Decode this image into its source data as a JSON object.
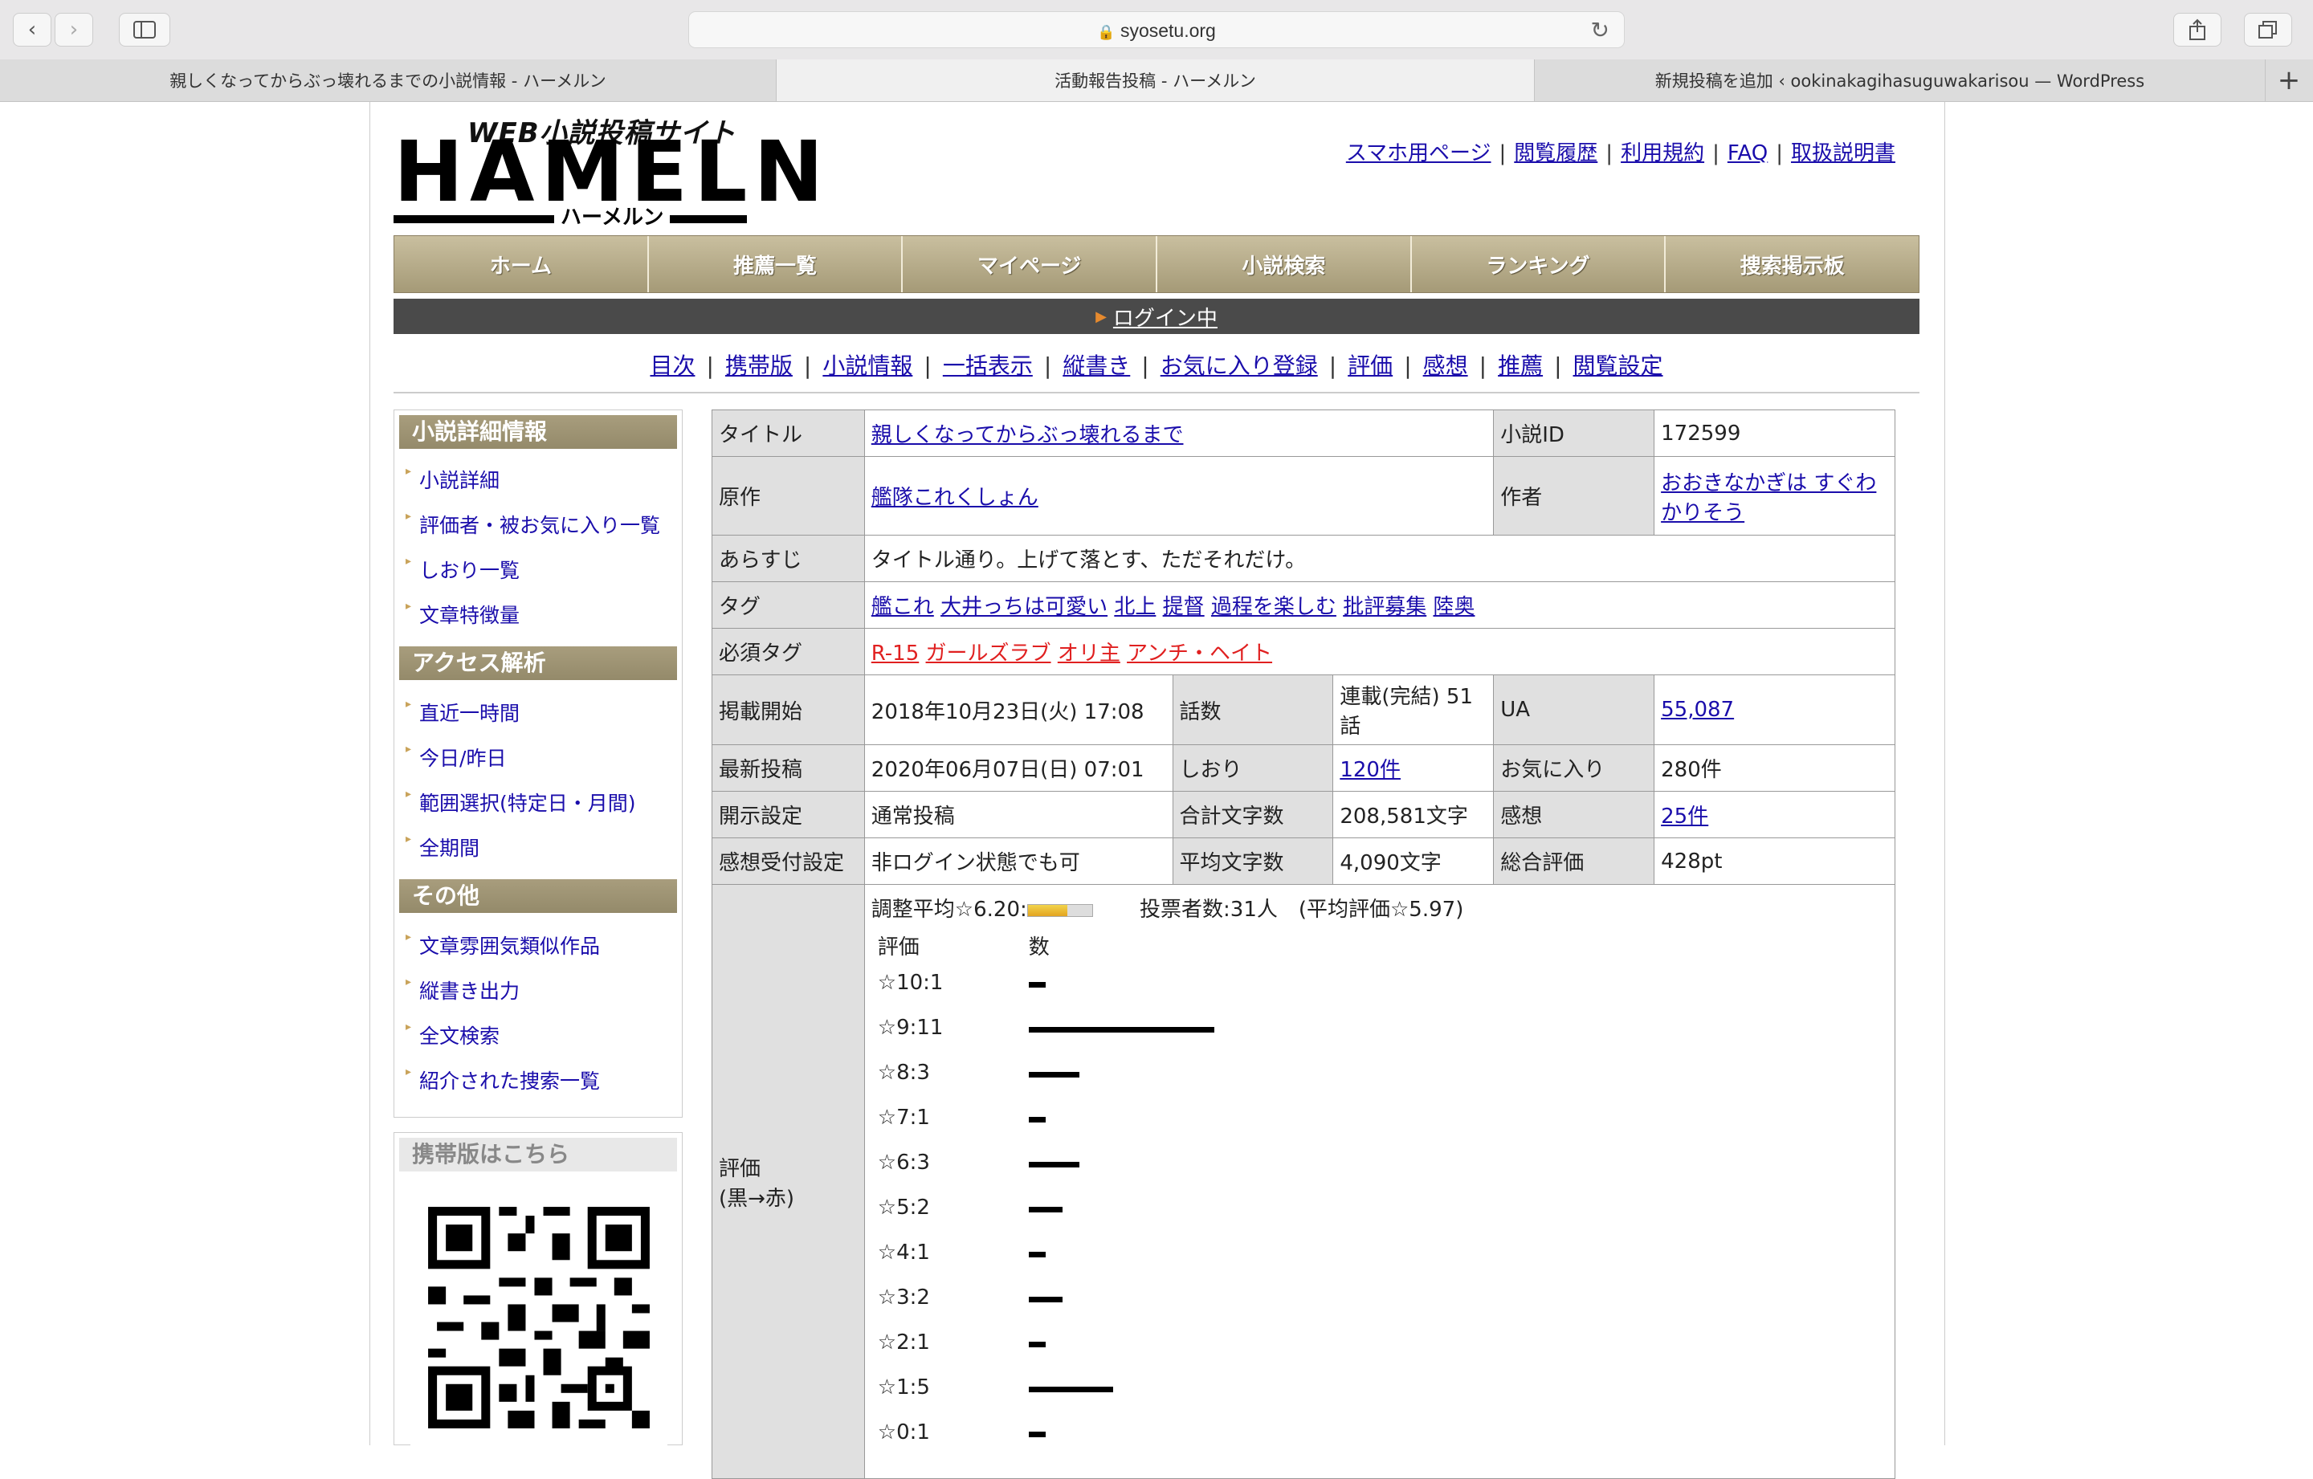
{
  "browser": {
    "address": "syosetu.org",
    "tabs": [
      {
        "label": "親しくなってからぶっ壊れるまでの小説情報 - ハーメルン",
        "active": false
      },
      {
        "label": "活動報告投稿 - ハーメルン",
        "active": true
      },
      {
        "label": "新規投稿を追加 ‹ ookinakagihasuguwakarisou — WordPress",
        "active": false
      }
    ],
    "newtab": "+"
  },
  "logo": {
    "sub": "WEB小説投稿サイト",
    "main": "HAMELN",
    "kana": "ハーメルン"
  },
  "header_links": [
    "スマホ用ページ",
    "閲覧履歴",
    "利用規約",
    "FAQ",
    "取扱説明書"
  ],
  "gnav": [
    "ホーム",
    "推薦一覧",
    "マイページ",
    "小説検索",
    "ランキング",
    "捜索掲示板"
  ],
  "login_label": "ログイン中",
  "subnav": [
    "目次",
    "携帯版",
    "小説情報",
    "一括表示",
    "縦書き",
    "お気に入り登録",
    "評価",
    "感想",
    "推薦",
    "閲覧設定"
  ],
  "sidebar": {
    "sections": [
      {
        "title": "小説詳細情報",
        "items": [
          "小説詳細",
          "評価者・被お気に入り一覧",
          "しおり一覧",
          "文章特徴量"
        ]
      },
      {
        "title": "アクセス解析",
        "items": [
          "直近一時間",
          "今日/昨日",
          "範囲選択(特定日・月間)",
          "全期間"
        ]
      },
      {
        "title": "その他",
        "items": [
          "文章雰囲気類似作品",
          "縦書き出力",
          "全文検索",
          "紹介された捜索一覧"
        ]
      }
    ],
    "mobile_title": "携帯版はこちら"
  },
  "info": {
    "title_label": "タイトル",
    "title": "親しくなってからぶっ壊れるまで",
    "id_label": "小説ID",
    "id": "172599",
    "original_label": "原作",
    "original": "艦隊これくしょん",
    "author_label": "作者",
    "author": "おおきなかぎは すぐわかりそう",
    "synopsis_label": "あらすじ",
    "synopsis": "タイトル通り。上げて落とす、ただそれだけ。",
    "tags_label": "タグ",
    "tags": [
      "艦これ",
      "大井っちは可愛い",
      "北上",
      "提督",
      "過程を楽しむ",
      "批評募集",
      "陸奥"
    ],
    "req_tags_label": "必須タグ",
    "req_tags": [
      "R-15",
      "ガールズラブ",
      "オリ主",
      "アンチ・ヘイト"
    ],
    "start_label": "掲載開始",
    "start": "2018年10月23日(火) 17:08",
    "episodes_label": "話数",
    "episodes": "連載(完結) 51話",
    "ua_label": "UA",
    "ua": "55,087",
    "latest_label": "最新投稿",
    "latest": "2020年06月07日(日) 07:01",
    "bookmarks_label": "しおり",
    "bookmarks": "120件",
    "fav_label": "お気に入り",
    "fav": "280件",
    "disclosure_label": "開示設定",
    "disclosure": "通常投稿",
    "chars_label": "合計文字数",
    "chars": "208,581文字",
    "reviews_label": "感想",
    "reviews": "25件",
    "feedback_label": "感想受付設定",
    "feedback": "非ログイン状態でも可",
    "avgchars_label": "平均文字数",
    "avgchars": "4,090文字",
    "total_label": "総合評価",
    "total": "428pt",
    "rating_label": "評価",
    "rating_sub": "(黒→赤)",
    "rating_avg": "調整平均☆6.20:",
    "rating_meter": 0.62,
    "voters": "投票者数:31人　(平均評価☆5.97)",
    "col_rating": "評価",
    "col_count": "数"
  },
  "chart_data": {
    "type": "bar",
    "categories": [
      "☆10:1",
      "☆9:11",
      "☆8:3",
      "☆7:1",
      "☆6:3",
      "☆5:2",
      "☆4:1",
      "☆3:2",
      "☆2:1",
      "☆1:5",
      "☆0:1"
    ],
    "values": [
      1,
      11,
      3,
      1,
      3,
      2,
      1,
      2,
      1,
      5,
      1
    ]
  }
}
